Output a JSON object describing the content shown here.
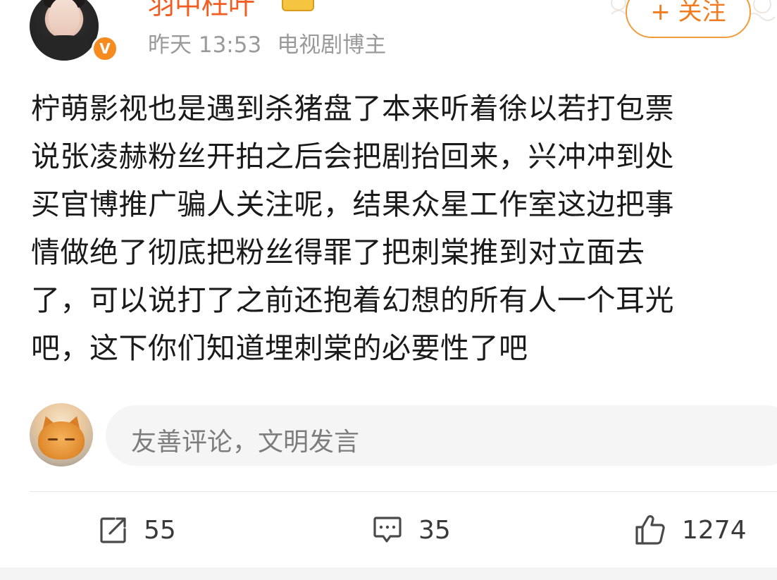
{
  "user": {
    "name": "羽中枉叶",
    "time": "昨天 13:53",
    "role": "电视剧博主",
    "verified_badge": "V",
    "follow_label": "+ 关注"
  },
  "post": {
    "lines": [
      "柠萌影视也是遇到杀猪盘了本来听着徐以若打包票",
      "说张凌赫粉丝开拍之后会把剧抬回来，兴冲冲到处",
      "买官博推广骗人关注呢，结果众星工作室这边把事",
      "情做绝了彻底把粉丝得罪了把刺棠推到对立面去",
      "了，可以说打了之前还抱着幻想的所有人一个耳光",
      "吧，这下你们知道埋刺棠的必要性了吧"
    ]
  },
  "composer": {
    "placeholder": "友善评论，文明发言"
  },
  "actions": {
    "share_count": "55",
    "comment_count": "35",
    "like_count": "1274"
  },
  "colors": {
    "accent_orange": "#f37b1f",
    "username_orange": "#f25d22",
    "badge_orange": "#f68c1f",
    "meta_gray": "#9a9a9a"
  },
  "icons": {
    "share": "share-icon",
    "comment": "comment-icon",
    "like": "thumbs-up-icon",
    "verified": "verified-badge-icon"
  }
}
